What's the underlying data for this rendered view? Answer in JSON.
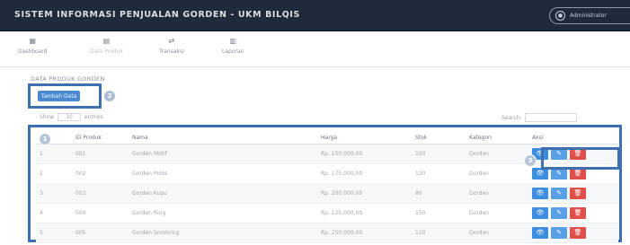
{
  "header": {
    "app_title": "SISTEM INFORMASI PENJUALAN GORDEN - UKM BILQIS",
    "user_label": "Administrator",
    "colors": {
      "bar": "#1f2a3a",
      "accent": "#3e6fb0",
      "primary": "#4b8ad1",
      "danger": "#e0504b"
    }
  },
  "nav": {
    "items": [
      {
        "icon": "▦",
        "icon_name": "dashboard-icon",
        "label": "Dashboard"
      },
      {
        "icon": "▤",
        "icon_name": "product-icon",
        "label": "Data Produk"
      },
      {
        "icon": "⇄",
        "icon_name": "transaction-icon",
        "label": "Transaksi"
      },
      {
        "icon": "▥",
        "icon_name": "report-icon",
        "label": "Laporan"
      }
    ],
    "active": "Data Produk"
  },
  "page": {
    "heading": "DATA PRODUK GORDEN",
    "add_button": "Tambah Data",
    "length_prefix": "Show",
    "length_value": "10",
    "length_suffix": "entries",
    "search_label": "Search:"
  },
  "markers": {
    "table": "1",
    "add": "2",
    "actions": "3"
  },
  "table": {
    "columns": [
      "",
      "ID Produk",
      "Nama",
      "Harga",
      "Stok",
      "Kategori",
      "Aksi"
    ],
    "rows": [
      {
        "no": "1",
        "id": "001",
        "nama": "Gorden Motif",
        "harga": "Rp. 150.000,00",
        "stok": "100",
        "kategori": "Gorden"
      },
      {
        "no": "2",
        "id": "002",
        "nama": "Gorden Polos",
        "harga": "Rp. 175.000,00",
        "stok": "120",
        "kategori": "Gorden"
      },
      {
        "no": "3",
        "id": "003",
        "nama": "Gorden Kupu",
        "harga": "Rp. 200.000,00",
        "stok": "80",
        "kategori": "Gorden"
      },
      {
        "no": "4",
        "id": "004",
        "nama": "Gorden Ring",
        "harga": "Rp. 125.000,00",
        "stok": "150",
        "kategori": "Gorden"
      },
      {
        "no": "5",
        "id": "005",
        "nama": "Gorden Smokring",
        "harga": "Rp. 250.000,00",
        "stok": "110",
        "kategori": "Gorden"
      }
    ],
    "actions": {
      "view": "👁",
      "edit": "✎",
      "delete": "🗑"
    }
  }
}
